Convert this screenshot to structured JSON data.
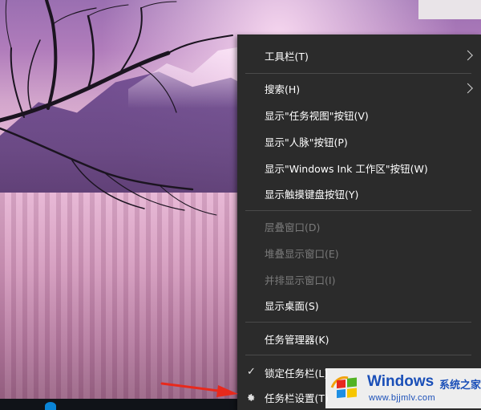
{
  "context_menu": {
    "items": [
      {
        "label": "工具栏(T)",
        "submenu": true,
        "enabled": true
      },
      {
        "label": "搜索(H)",
        "submenu": true,
        "enabled": true
      },
      {
        "label": "显示\"任务视图\"按钮(V)",
        "enabled": true
      },
      {
        "label": "显示\"人脉\"按钮(P)",
        "enabled": true
      },
      {
        "label": "显示\"Windows Ink 工作区\"按钮(W)",
        "enabled": true
      },
      {
        "label": "显示触摸键盘按钮(Y)",
        "enabled": true
      },
      {
        "label": "层叠窗口(D)",
        "enabled": false
      },
      {
        "label": "堆叠显示窗口(E)",
        "enabled": false
      },
      {
        "label": "并排显示窗口(I)",
        "enabled": false
      },
      {
        "label": "显示桌面(S)",
        "enabled": true
      },
      {
        "label": "任务管理器(K)",
        "enabled": true
      },
      {
        "label": "锁定任务栏(L)",
        "checked": true,
        "enabled": true
      },
      {
        "label": "任务栏设置(T)",
        "icon": "gear-icon",
        "enabled": true
      }
    ]
  },
  "watermark": {
    "title": "Windows",
    "subtitle": "系统之家",
    "url": "www.bjjmlv.com"
  },
  "colors": {
    "menu_bg": "#2b2b2b",
    "menu_text": "#ffffff",
    "disabled_text": "#7b7b7b",
    "arrow": "#e8291c",
    "watermark_blue": "#1a4fb8"
  }
}
